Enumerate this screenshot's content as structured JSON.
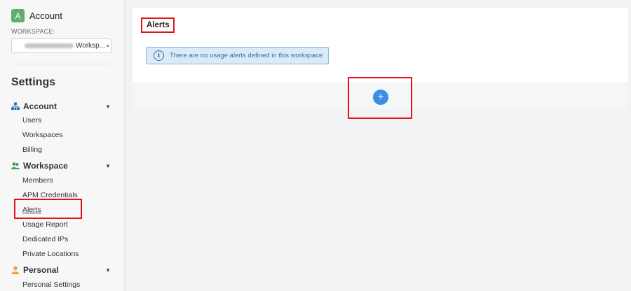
{
  "account": {
    "avatar_letter": "A",
    "name": "Account"
  },
  "workspace": {
    "label": "WORKSPACE:",
    "selected_suffix": "Worksp...",
    "chevron": "▾"
  },
  "settings_title": "Settings",
  "sidebar": {
    "sections": [
      {
        "label": "Account",
        "icon": "sitemap-icon",
        "items": [
          "Users",
          "Workspaces",
          "Billing"
        ]
      },
      {
        "label": "Workspace",
        "icon": "users-icon",
        "items": [
          "Members",
          "APM Credentials",
          "Alerts",
          "Usage Report",
          "Dedicated IPs",
          "Private Locations"
        ]
      },
      {
        "label": "Personal",
        "icon": "user-icon",
        "items": [
          "Personal Settings"
        ]
      }
    ],
    "active_item": "Alerts"
  },
  "main": {
    "title": "Alerts",
    "info_message": "There are no usage alerts defined in this workspace",
    "add_symbol": "+"
  },
  "colors": {
    "accent": "#3d8ee0",
    "avatar": "#5fae6f",
    "info_bg": "#dbeaf6",
    "highlight": "#e0121a"
  }
}
